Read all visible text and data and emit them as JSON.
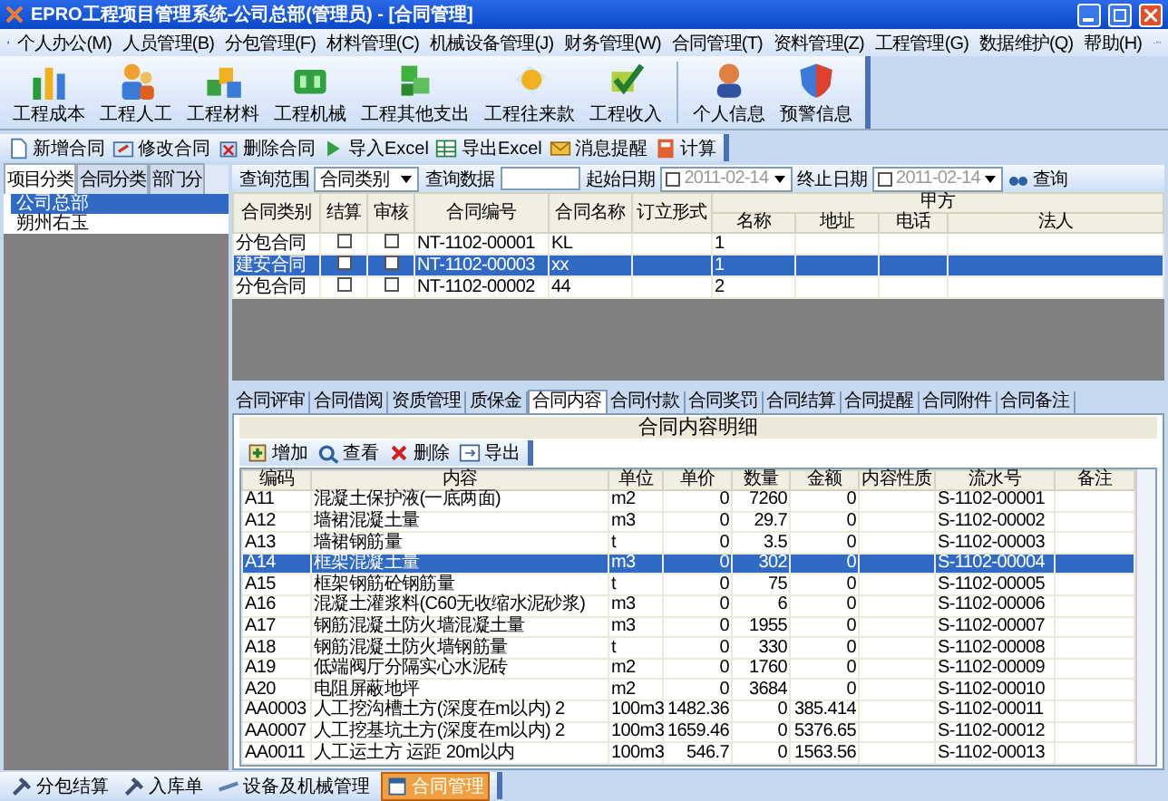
{
  "window": {
    "title": "EPRO工程项目管理系统-公司总部(管理员) - [合同管理]"
  },
  "menu": {
    "items": [
      "个人办公(M)",
      "人员管理(B)",
      "分包管理(F)",
      "材料管理(C)",
      "机械设备管理(J)",
      "财务管理(W)",
      "合同管理(T)",
      "资料管理(Z)",
      "工程管理(G)",
      "数据维护(Q)",
      "帮助(H)"
    ]
  },
  "main_toolbar": {
    "buttons": [
      "工程成本",
      "工程人工",
      "工程材料",
      "工程机械",
      "工程其他支出",
      "工程往来款",
      "工程收入"
    ],
    "info_buttons": [
      "个人信息",
      "预警信息"
    ]
  },
  "action_toolbar": {
    "buttons": [
      "新增合同",
      "修改合同",
      "删除合同",
      "导入Excel",
      "导出Excel",
      "消息提醒",
      "计算"
    ]
  },
  "left_panel": {
    "tabs": [
      {
        "label": "项目分类",
        "selected": true
      },
      {
        "label": "合同分类",
        "selected": false
      },
      {
        "label": "部门分",
        "selected": false
      }
    ],
    "tree": [
      {
        "label": "公司总部",
        "selected": true
      },
      {
        "label": "朔州右玉",
        "selected": false
      }
    ]
  },
  "filter_bar": {
    "range_label": "查询范围",
    "range_value": "合同类别",
    "data_label": "查询数据",
    "start_label": "起始日期",
    "start_date": {
      "value": "2011-02-14",
      "checked": false
    },
    "end_label": "终止日期",
    "end_date": {
      "value": "2011-02-14",
      "checked": false
    },
    "search_button": "查询"
  },
  "contracts_table": {
    "columns": [
      "合同类别",
      "结算",
      "审核",
      "合同编号",
      "合同名称",
      "订立形式"
    ],
    "group_header": "甲方",
    "group_columns": [
      "名称",
      "地址",
      "电话",
      "法人"
    ],
    "rows": [
      {
        "type": "分包合同",
        "settled": false,
        "reviewed": false,
        "number": "NT-1102-00001",
        "name": "KL",
        "party_name": "1",
        "selected": false
      },
      {
        "type": "建安合同",
        "settled": false,
        "reviewed": false,
        "number": "NT-1102-00003",
        "name": "xx",
        "party_name": "1",
        "selected": true
      },
      {
        "type": "分包合同",
        "settled": false,
        "reviewed": false,
        "number": "NT-1102-00002",
        "name": "44",
        "party_name": "2",
        "selected": false
      }
    ]
  },
  "detail_tabs": [
    {
      "label": "合同评审",
      "selected": false
    },
    {
      "label": "合同借阅",
      "selected": false
    },
    {
      "label": "资质管理",
      "selected": false
    },
    {
      "label": "质保金",
      "selected": false
    },
    {
      "label": "合同内容",
      "selected": true
    },
    {
      "label": "合同付款",
      "selected": false
    },
    {
      "label": "合同奖罚",
      "selected": false
    },
    {
      "label": "合同结算",
      "selected": false
    },
    {
      "label": "合同提醒",
      "selected": false
    },
    {
      "label": "合同附件",
      "selected": false
    },
    {
      "label": "合同备注",
      "selected": false
    }
  ],
  "detail_panel": {
    "title": "合同内容明细",
    "toolbar": [
      "增加",
      "查看",
      "删除",
      "导出"
    ],
    "columns": [
      "编码",
      "内容",
      "单位",
      "单价",
      "数量",
      "金额",
      "内容性质",
      "流水号",
      "备注"
    ],
    "rows": [
      {
        "code": "A11",
        "content": "混凝土保护液(一底两面)",
        "unit": "m2",
        "price": "0",
        "qty": "7260",
        "amount": "0",
        "serial": "S-1102-00001",
        "selected": false
      },
      {
        "code": "A12",
        "content": "墙裙混凝土量",
        "unit": "m3",
        "price": "0",
        "qty": "29.7",
        "amount": "0",
        "serial": "S-1102-00002",
        "selected": false
      },
      {
        "code": "A13",
        "content": "墙裙钢筋量",
        "unit": "t",
        "price": "0",
        "qty": "3.5",
        "amount": "0",
        "serial": "S-1102-00003",
        "selected": false
      },
      {
        "code": "A14",
        "content": "框架混凝土量",
        "unit": "m3",
        "price": "0",
        "qty": "302",
        "amount": "0",
        "serial": "S-1102-00004",
        "selected": true
      },
      {
        "code": "A15",
        "content": "框架钢筋砼钢筋量",
        "unit": "t",
        "price": "0",
        "qty": "75",
        "amount": "0",
        "serial": "S-1102-00005",
        "selected": false
      },
      {
        "code": "A16",
        "content": "混凝土灌浆料(C60无收缩水泥砂浆)",
        "unit": "m3",
        "price": "0",
        "qty": "6",
        "amount": "0",
        "serial": "S-1102-00006",
        "selected": false
      },
      {
        "code": "A17",
        "content": "钢筋混凝土防火墙混凝土量",
        "unit": "m3",
        "price": "0",
        "qty": "1955",
        "amount": "0",
        "serial": "S-1102-00007",
        "selected": false
      },
      {
        "code": "A18",
        "content": "钢筋混凝土防火墙钢筋量",
        "unit": "t",
        "price": "0",
        "qty": "330",
        "amount": "0",
        "serial": "S-1102-00008",
        "selected": false
      },
      {
        "code": "A19",
        "content": "低端阀厅分隔实心水泥砖",
        "unit": "m2",
        "price": "0",
        "qty": "1760",
        "amount": "0",
        "serial": "S-1102-00009",
        "selected": false
      },
      {
        "code": "A20",
        "content": "电阻屏蔽地坪",
        "unit": "m2",
        "price": "0",
        "qty": "3684",
        "amount": "0",
        "serial": "S-1102-00010",
        "selected": false
      },
      {
        "code": "AA0003",
        "content": "人工挖沟槽土方(深度在m以内) 2",
        "unit": "100m3",
        "price": "1482.36",
        "qty": "0",
        "amount": "385.414",
        "serial": "S-1102-00011",
        "selected": false
      },
      {
        "code": "AA0007",
        "content": "人工挖基坑土方(深度在m以内) 2",
        "unit": "100m3",
        "price": "1659.46",
        "qty": "0",
        "amount": "5376.65",
        "serial": "S-1102-00012",
        "selected": false
      },
      {
        "code": "AA0011",
        "content": "人工运土方 运距 20m以内",
        "unit": "100m3",
        "price": "546.7",
        "qty": "0",
        "amount": "1563.56",
        "serial": "S-1102-00013",
        "selected": false
      }
    ]
  },
  "taskbar": {
    "items": [
      {
        "label": "分包结算",
        "selected": false
      },
      {
        "label": "入库单",
        "selected": false
      },
      {
        "label": "设备及机械管理",
        "selected": false
      },
      {
        "label": "合同管理",
        "selected": true
      }
    ]
  }
}
